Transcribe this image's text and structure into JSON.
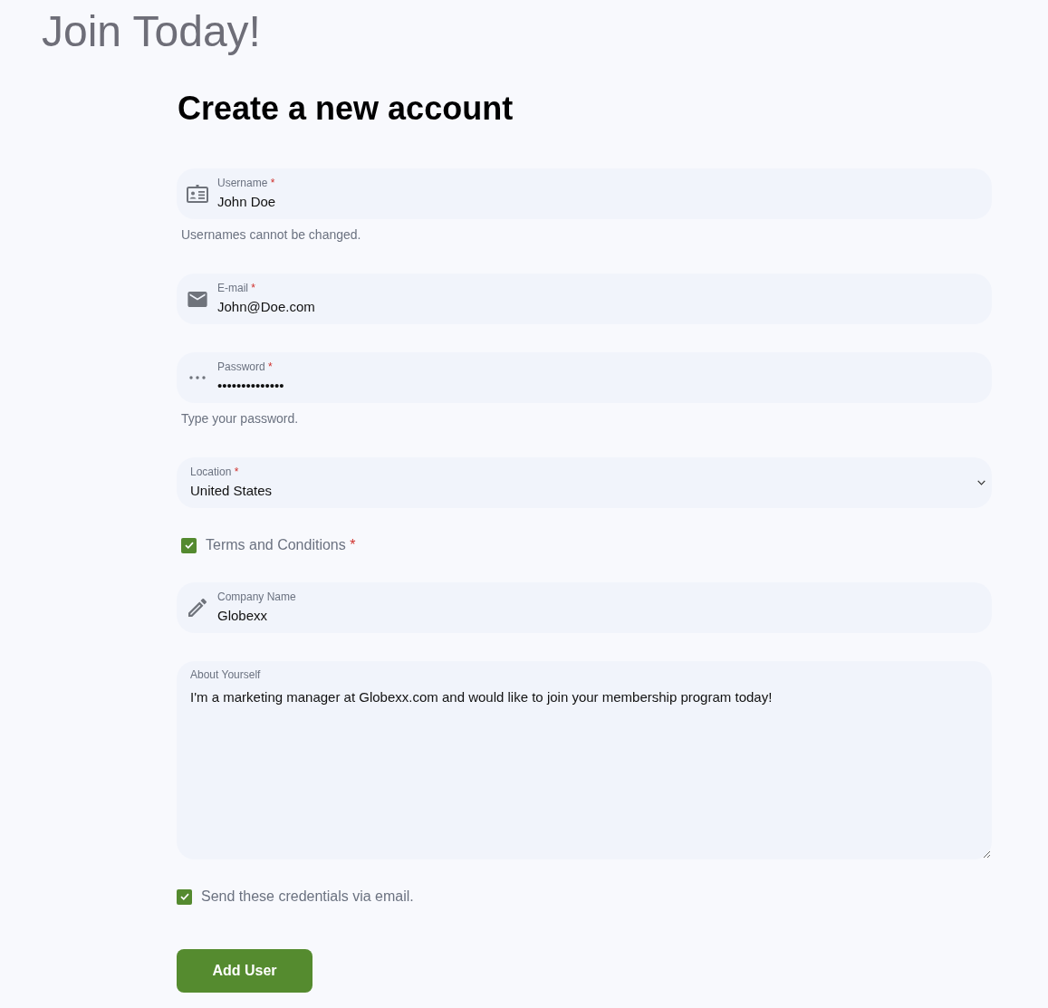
{
  "page": {
    "title": "Join Today!"
  },
  "form": {
    "heading": "Create a new account",
    "fields": [
      {
        "kind": "username",
        "label": "Username",
        "required_mark": "*",
        "value": "John Doe",
        "help": "Usernames cannot be changed."
      },
      {
        "kind": "email",
        "label": "E-mail",
        "required_mark": "*",
        "value": "John@Doe.com"
      },
      {
        "kind": "password",
        "label": "Password",
        "required_mark": "*",
        "value": "••••••••••••••",
        "help": "Type your password."
      },
      {
        "kind": "select",
        "label": "Location",
        "required_mark": "*",
        "value": "United States"
      },
      {
        "kind": "checkbox",
        "label": "Terms and Conditions",
        "required_mark": "*",
        "checked": true
      },
      {
        "kind": "company",
        "label": "Company Name",
        "value": "Globexx"
      },
      {
        "kind": "textarea",
        "label": "About Yourself",
        "value": "I'm a marketing manager at Globexx.com and would like to join your membership program today!"
      }
    ],
    "send_credentials": {
      "label": "Send these credentials via email.",
      "checked": true
    },
    "submit": {
      "label": "Add User"
    }
  }
}
